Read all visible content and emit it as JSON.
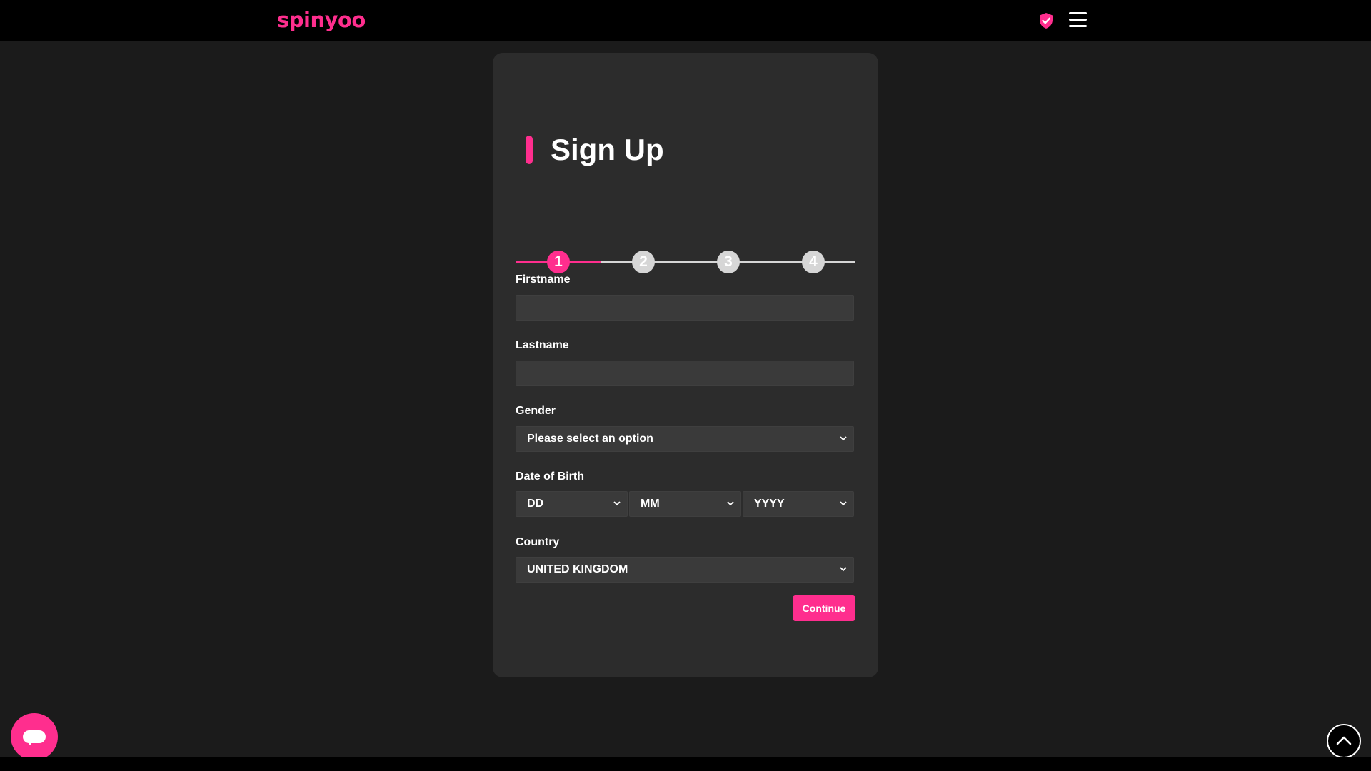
{
  "header": {
    "logo_text": "spinyoo",
    "icons": [
      "shield-check-icon",
      "hamburger-menu-icon"
    ],
    "brand_color": "#ff2e8e"
  },
  "signup": {
    "title": "Sign Up",
    "steps": [
      "1",
      "2",
      "3",
      "4"
    ],
    "active_step": 1,
    "fields": {
      "firstname_label": "Firstname",
      "firstname_value": "",
      "lastname_label": "Lastname",
      "lastname_value": "",
      "gender_label": "Gender",
      "gender_value": "Please select an option",
      "dob_label": "Date of Birth",
      "dob_day": "DD",
      "dob_month": "MM",
      "dob_year": "YYYY",
      "country_label": "Country",
      "country_value": "UNITED KINGDOM"
    },
    "continue_label": "Continue"
  },
  "floating": {
    "chat_icon": "chat-bubble-icon",
    "scroll_icon": "chevron-up-icon"
  }
}
